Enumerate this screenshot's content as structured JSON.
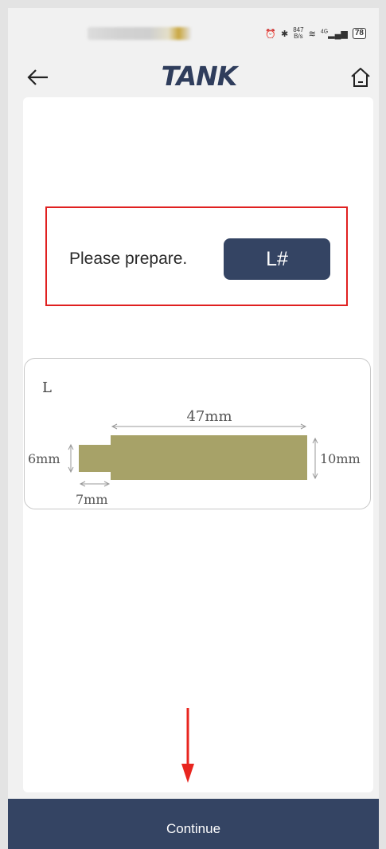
{
  "status_bar": {
    "network_speed_value": "847",
    "network_speed_unit": "B/s",
    "signal_label": "4G",
    "battery": "78"
  },
  "header": {
    "logo": "TANK"
  },
  "prepare": {
    "text": "Please prepare.",
    "item": "L#"
  },
  "diagram": {
    "title": "L",
    "length_label": "47mm",
    "left_height_label": "6mm",
    "right_height_label": "10mm",
    "step_length_label": "7mm",
    "part_color": "#a7a268"
  },
  "footer": {
    "continue_label": "Continue"
  },
  "colors": {
    "primary": "#344463",
    "highlight_border": "#e02020",
    "arrow": "#e8251f"
  }
}
